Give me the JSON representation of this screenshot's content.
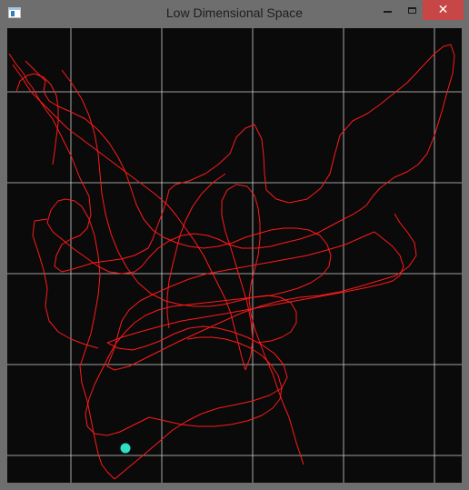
{
  "window": {
    "title": "Low Dimensional Space",
    "controls": {
      "minimize": "minimize",
      "maximize": "maximize",
      "close": "close"
    }
  },
  "colors": {
    "background": "#0a0a0a",
    "grid": "#d0d0d0",
    "trajectory": "#ff1a1a",
    "current_point": "#2de0c4",
    "titlebar": "#6e6e6e",
    "close_button": "#c74646"
  },
  "icons": [
    "app-window-icon",
    "minimize-icon",
    "maximize-icon",
    "close-icon"
  ]
}
